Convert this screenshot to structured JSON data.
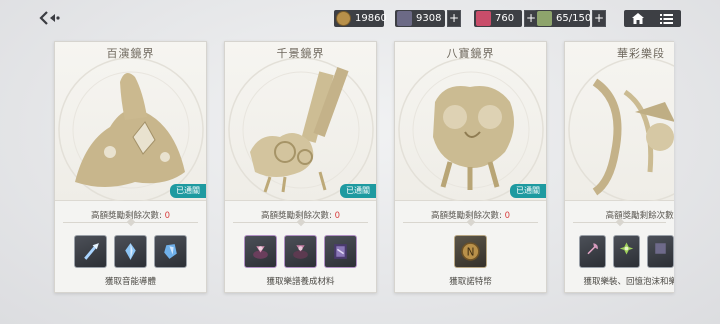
{
  "topbar": {
    "resources": [
      {
        "name": "coin-icon",
        "value": "19860",
        "has_plus": false,
        "color": "#b8904a"
      },
      {
        "name": "crystal-icon",
        "value": "9308",
        "has_plus": true,
        "color": "#8e87a8"
      },
      {
        "name": "ruby-icon",
        "value": "760",
        "has_plus": true,
        "color": "#c94d6a"
      },
      {
        "name": "stamina-icon",
        "value": "65/150",
        "has_plus": true,
        "color": "#9bb27a"
      }
    ]
  },
  "cards": [
    {
      "title": "百演鏡界",
      "badge": "已通關",
      "remain_label": "高額獎勵剩餘次數: ",
      "remain_value": "0",
      "reward": "獲取音能導體",
      "items": [
        "blue-crystal-icon",
        "blue-crystal-icon",
        "blue-crystal-icon"
      ]
    },
    {
      "title": "千景鏡界",
      "badge": "已通關",
      "remain_label": "高額獎勵剩餘次數: ",
      "remain_value": "0",
      "reward": "獲取樂譜養成材料",
      "items": [
        "purple-material-icon",
        "purple-material-icon",
        "purple-book-icon"
      ]
    },
    {
      "title": "八寶鏡界",
      "badge": "已通關",
      "remain_label": "高額獎勵剩餘次數: ",
      "remain_value": "0",
      "reward": "獲取諾特幣",
      "items": [
        "note-coin-icon"
      ]
    },
    {
      "title": "華彩樂段",
      "badge": "",
      "remain_label": "高額獎勵剩餘次數:",
      "remain_value": "",
      "reward": "獲取樂裝、回憶泡沫和樂裝材料",
      "items": [
        "axe-icon",
        "green-gem-icon",
        "partial-item-icon"
      ]
    }
  ]
}
